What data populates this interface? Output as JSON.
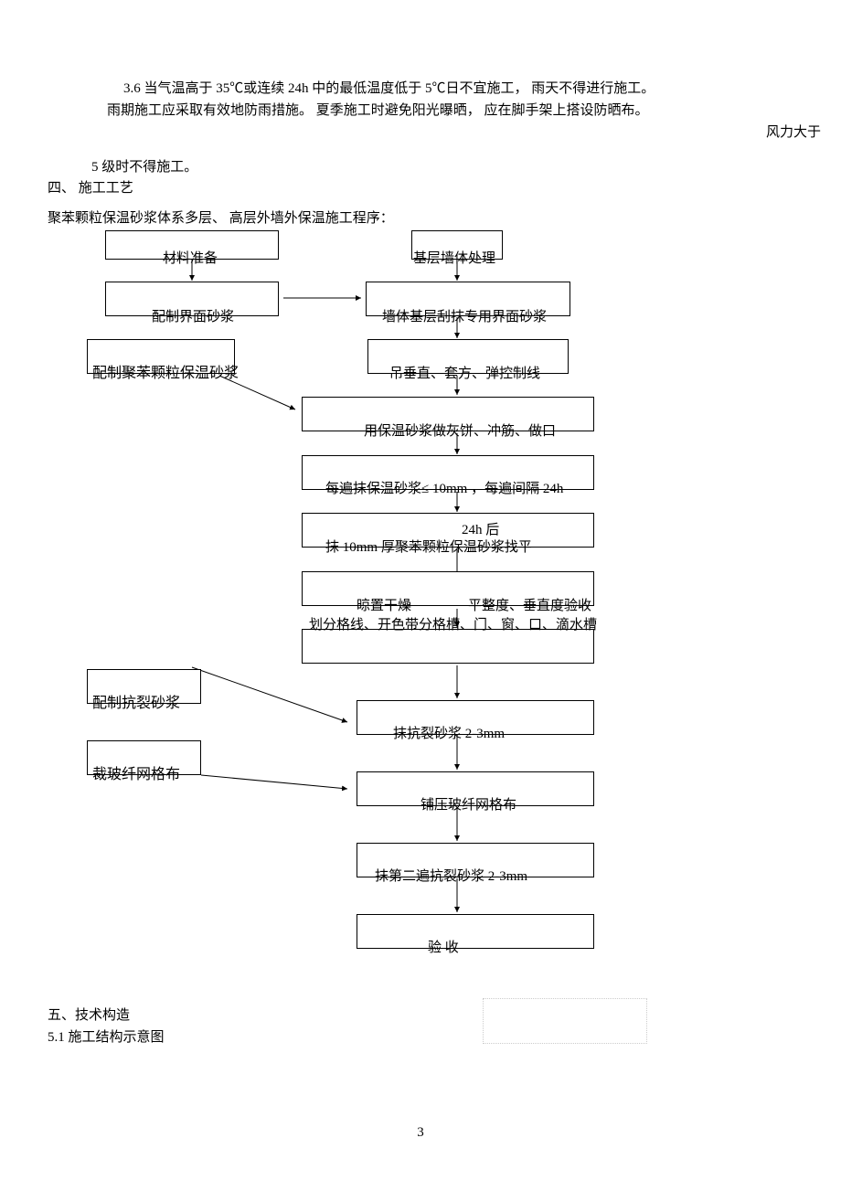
{
  "paragraphs": {
    "p1": "3.6 当气温高于 35℃或连续 24h 中的最低温度低于 5℃日不宜施工， 雨天不得进行施工。",
    "p2": "雨期施工应采取有效地防雨措施。   夏季施工时避免阳光曝晒，   应在脚手架上搭设防晒布。",
    "p3": "风力大于",
    "p4": "5 级时不得施工。",
    "h4": "四、 施工工艺",
    "p5": "聚苯颗粒保温砂浆体系多层、 高层外墙外保温施工程序：",
    "h5": "五、技术构造",
    "p6": "5.1   施工结构示意图"
  },
  "flow": {
    "b1": "材料准备",
    "b2": "基层墙体处理",
    "b3": "配制界面砂浆",
    "b4": "墙体基层刮抹专用界面砂浆",
    "b5": "配制聚苯颗粒保温砂浆",
    "b6": "吊垂直、套方、弹控制线",
    "b7": "用保温砂浆做灰饼、冲筋、做口",
    "b8": "每遍抹保温砂浆≤ 10mm ，每遍间隔 24h",
    "b9a": "24h 后",
    "b9b": "抹 10mm 厚聚苯颗粒保温砂浆找平",
    "b10a": "晾置干燥",
    "b10b": "平整度、垂直度验收",
    "b11": "划分格线、开色带分格槽、门、窗、口、滴水槽",
    "b12": "配制抗裂砂浆",
    "b13": "抹抗裂砂浆   2-3mm",
    "b14": "裁玻纤网格布",
    "b15": "铺压玻纤网格布",
    "b16": "抹第二遍抗裂砂浆   2-3mm",
    "b17": "验           收"
  },
  "page_number": "3"
}
